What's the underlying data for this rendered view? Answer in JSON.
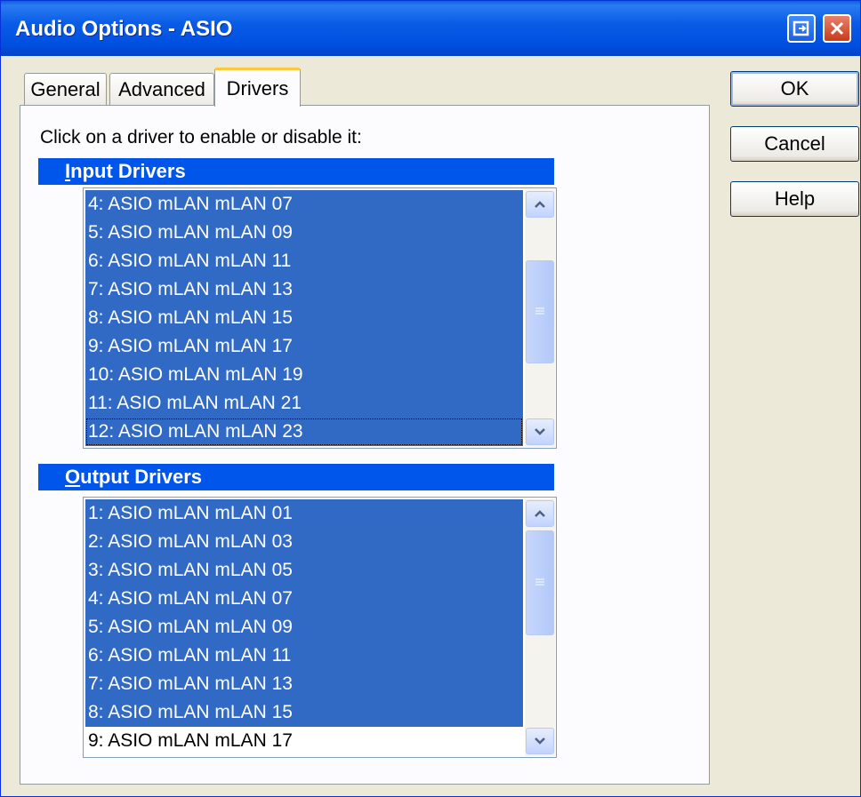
{
  "window": {
    "title": "Audio Options - ASIO"
  },
  "tabs": [
    {
      "label": "General",
      "active": false
    },
    {
      "label": "Advanced",
      "active": false
    },
    {
      "label": "Drivers",
      "active": true
    }
  ],
  "instruction": "Click on a driver to enable or disable it:",
  "input_drivers": {
    "header_first": "I",
    "header_rest": "nput Drivers",
    "items": [
      {
        "label": "4: ASIO mLAN mLAN 07",
        "selected": true
      },
      {
        "label": "5: ASIO mLAN mLAN 09",
        "selected": true
      },
      {
        "label": "6: ASIO mLAN mLAN 11",
        "selected": true
      },
      {
        "label": "7: ASIO mLAN mLAN 13",
        "selected": true
      },
      {
        "label": "8: ASIO mLAN mLAN 15",
        "selected": true
      },
      {
        "label": "9: ASIO mLAN mLAN 17",
        "selected": true
      },
      {
        "label": "10: ASIO mLAN mLAN 19",
        "selected": true
      },
      {
        "label": "11: ASIO mLAN mLAN 21",
        "selected": true
      },
      {
        "label": "12: ASIO mLAN mLAN 23",
        "selected": true,
        "focused": true
      }
    ]
  },
  "output_drivers": {
    "header_first": "O",
    "header_rest": "utput Drivers",
    "items": [
      {
        "label": "1: ASIO mLAN mLAN 01",
        "selected": true
      },
      {
        "label": "2: ASIO mLAN mLAN 03",
        "selected": true
      },
      {
        "label": "3: ASIO mLAN mLAN 05",
        "selected": true
      },
      {
        "label": "4: ASIO mLAN mLAN 07",
        "selected": true
      },
      {
        "label": "5: ASIO mLAN mLAN 09",
        "selected": true
      },
      {
        "label": "6: ASIO mLAN mLAN 11",
        "selected": true
      },
      {
        "label": "7: ASIO mLAN mLAN 13",
        "selected": true
      },
      {
        "label": "8: ASIO mLAN mLAN 15",
        "selected": true
      },
      {
        "label": "9: ASIO mLAN mLAN 17",
        "selected": false
      }
    ]
  },
  "buttons": {
    "ok": "OK",
    "cancel": "Cancel",
    "help": "Help"
  },
  "icons": {
    "restore": "restore-icon",
    "close": "close-icon",
    "scroll_up": "chevron-up-icon",
    "scroll_down": "chevron-down-icon",
    "grip": "grip-icon"
  },
  "colors": {
    "titlebar": "#0055ea",
    "selection": "#316ac5",
    "section_header": "#0055ea"
  }
}
